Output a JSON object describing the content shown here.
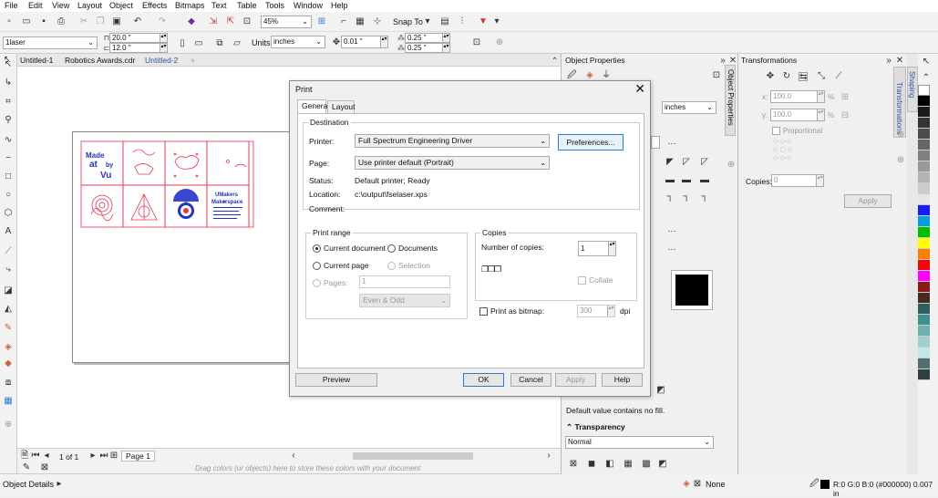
{
  "menu": [
    "File",
    "Edit",
    "View",
    "Layout",
    "Object",
    "Effects",
    "Bitmaps",
    "Text",
    "Table",
    "Tools",
    "Window",
    "Help"
  ],
  "toolbar": {
    "zoom": "45%",
    "snap_to": "Snap To"
  },
  "propbar": {
    "preset": "1laser",
    "width": "20.0 \"",
    "height": "12.0 \"",
    "units_label": "Units:",
    "units": "inches",
    "nudge": "0.01 \"",
    "dup_x": "0.25 \"",
    "dup_y": "0.25 \""
  },
  "doc_tabs": [
    "Untitled-1",
    "Robotics Awards.cdr",
    "Untitled-2"
  ],
  "artwork": {
    "made_at_by_vu": [
      "Made",
      "at",
      "by",
      "Vu"
    ],
    "umakers": [
      "UMakers",
      "Makerspace"
    ]
  },
  "object_properties": {
    "title": "Object Properties",
    "units": "inches",
    "fill_note": "Default value contains no fill.",
    "transparency_label": "Transparency",
    "transparency_mode": "Normal",
    "side_tab": "Object Properties"
  },
  "transformations": {
    "title": "Transformations",
    "x": "100.0",
    "y": "100.0",
    "pct": "%",
    "proportional": "Proportional",
    "copies_label": "Copies:",
    "copies": "0",
    "apply": "Apply",
    "side_tabs": [
      "Transformations",
      "Shaping"
    ]
  },
  "print_dialog": {
    "title": "Print",
    "tabs": [
      "General",
      "Layout"
    ],
    "destination": "Destination",
    "printer_label": "Printer:",
    "printer": "Full Spectrum Engineering Driver",
    "preferences": "Preferences...",
    "page_label": "Page:",
    "page": "Use printer default (Portrait)",
    "status_label": "Status:",
    "status": "Default printer; Ready",
    "location_label": "Location:",
    "location": "c:\\output\\fselaser.xps",
    "comment_label": "Comment:",
    "print_range": "Print range",
    "current_document": "Current document",
    "documents": "Documents",
    "current_page": "Current page",
    "selection": "Selection",
    "pages_label": "Pages:",
    "pages": "1",
    "even_odd": "Even & Odd",
    "copies": "Copies",
    "number_of_copies": "Number of copies:",
    "copies_value": "1",
    "collate": "Collate",
    "print_as_bitmap": "Print as bitmap:",
    "dpi_value": "300",
    "dpi": "dpi",
    "preview": "Preview",
    "ok": "OK",
    "cancel": "Cancel",
    "apply": "Apply",
    "help": "Help"
  },
  "bottombar": {
    "page_of": "1 of 1",
    "page_tab": "Page 1",
    "drag_hint": "Drag colors (or objects) here to store these colors with your document"
  },
  "statusbar": {
    "object_details": "Object Details",
    "fill": "None",
    "outline": "R:0 G:0 B:0 (#000000)  0.007 in"
  },
  "colors": {
    "accent": "#2a7ad6",
    "laser_red": "#e8344a",
    "blue": "#2233cc"
  }
}
